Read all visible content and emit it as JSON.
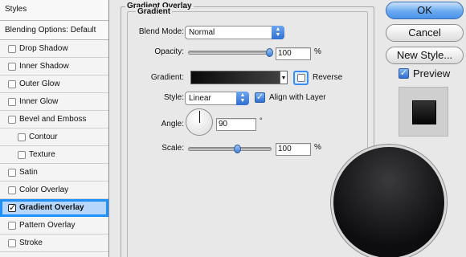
{
  "styles_panel": {
    "header": "Styles",
    "blending": "Blending Options: Default",
    "items": [
      {
        "label": "Drop Shadow",
        "checked": false
      },
      {
        "label": "Inner Shadow",
        "checked": false
      },
      {
        "label": "Outer Glow",
        "checked": false
      },
      {
        "label": "Inner Glow",
        "checked": false
      },
      {
        "label": "Bevel and Emboss",
        "checked": false
      },
      {
        "label": "Contour",
        "checked": false
      },
      {
        "label": "Texture",
        "checked": false
      },
      {
        "label": "Satin",
        "checked": false
      },
      {
        "label": "Color Overlay",
        "checked": false
      },
      {
        "label": "Gradient Overlay",
        "checked": true
      },
      {
        "label": "Pattern Overlay",
        "checked": false
      },
      {
        "label": "Stroke",
        "checked": false
      }
    ]
  },
  "gradient_overlay": {
    "group_title": "Gradient Overlay",
    "section_title": "Gradient",
    "blend_mode_label": "Blend Mode:",
    "blend_mode_value": "Normal",
    "opacity_label": "Opacity:",
    "opacity_value": "100",
    "opacity_unit": "%",
    "opacity_level": 1.0,
    "gradient_label": "Gradient:",
    "reverse_label": "Reverse",
    "reverse_checked": false,
    "style_label": "Style:",
    "style_value": "Linear",
    "align_label": "Align with Layer",
    "align_checked": true,
    "angle_label": "Angle:",
    "angle_value": "90",
    "angle_unit": "°",
    "scale_label": "Scale:",
    "scale_value": "100",
    "scale_unit": "%",
    "scale_level": 0.5
  },
  "buttons": {
    "ok": "OK",
    "cancel": "Cancel",
    "new_style": "New Style...",
    "preview": "Preview",
    "preview_checked": true
  },
  "colors": {
    "selection_outline": "#1e90ff",
    "selection_fill": "#b6d7fb",
    "accent_blue": "#4a93ea"
  }
}
